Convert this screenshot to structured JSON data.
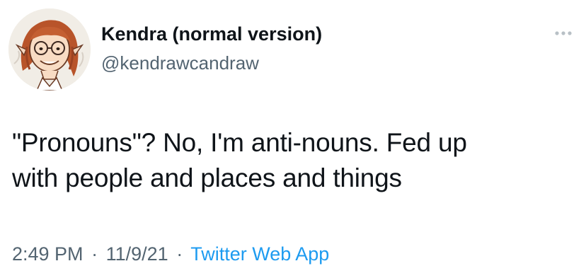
{
  "user": {
    "display_name": "Kendra (normal version)",
    "handle": "@kendrawcandraw",
    "avatar_icon": "cartoon-avatar"
  },
  "menu": {
    "icon": "more-dots-icon"
  },
  "tweet": {
    "lines": [
      "\"Pronouns\"? No, I'm anti-nouns. Fed up",
      "with people and places and things"
    ]
  },
  "meta": {
    "time": "2:49 PM",
    "separator": "·",
    "date": "11/9/21",
    "source": "Twitter Web App"
  },
  "colors": {
    "text": "#0f1419",
    "secondary": "#536471",
    "link": "#1d9bf0"
  }
}
